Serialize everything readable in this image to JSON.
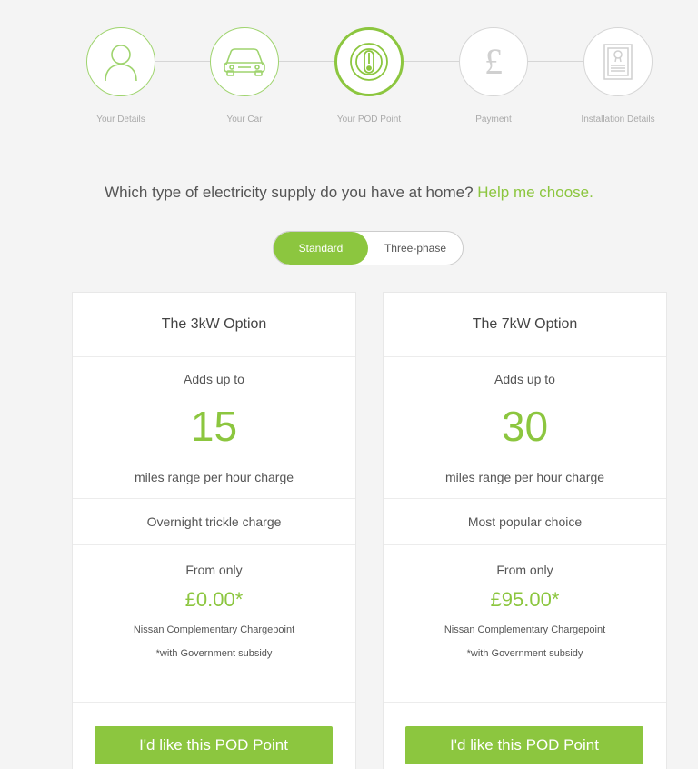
{
  "stepper": {
    "steps": [
      {
        "label": "Your Details",
        "icon": "person-icon",
        "state": "done"
      },
      {
        "label": "Your Car",
        "icon": "car-icon",
        "state": "done"
      },
      {
        "label": "Your POD Point",
        "icon": "charger-icon",
        "state": "active"
      },
      {
        "label": "Payment",
        "icon": "pound-icon",
        "state": "todo"
      },
      {
        "label": "Installation Details",
        "icon": "certificate-icon",
        "state": "todo"
      }
    ]
  },
  "question": {
    "text": "Which type of electricity supply do you have at home?",
    "help_link": "Help me choose."
  },
  "supply_toggle": {
    "options": [
      "Standard",
      "Three-phase"
    ],
    "selected": "Standard"
  },
  "cards": [
    {
      "title": "The 3kW Option",
      "adds_label": "Adds up to",
      "miles": "15",
      "miles_sub": "miles range per hour charge",
      "tag": "Overnight trickle charge",
      "from_label": "From only",
      "price": "£0.00*",
      "note1": "Nissan Complementary Chargepoint",
      "note2": "*with Government subsidy",
      "cta": "I'd like this POD Point"
    },
    {
      "title": "The 7kW Option",
      "adds_label": "Adds up to",
      "miles": "30",
      "miles_sub": "miles range per hour charge",
      "tag": "Most popular choice",
      "from_label": "From only",
      "price": "£95.00*",
      "note1": "Nissan Complementary Chargepoint",
      "note2": "*with Government subsidy",
      "cta": "I'd like this POD Point"
    }
  ],
  "colors": {
    "accent": "#8cc63f",
    "background": "#f4f4f4",
    "card": "#ffffff"
  }
}
